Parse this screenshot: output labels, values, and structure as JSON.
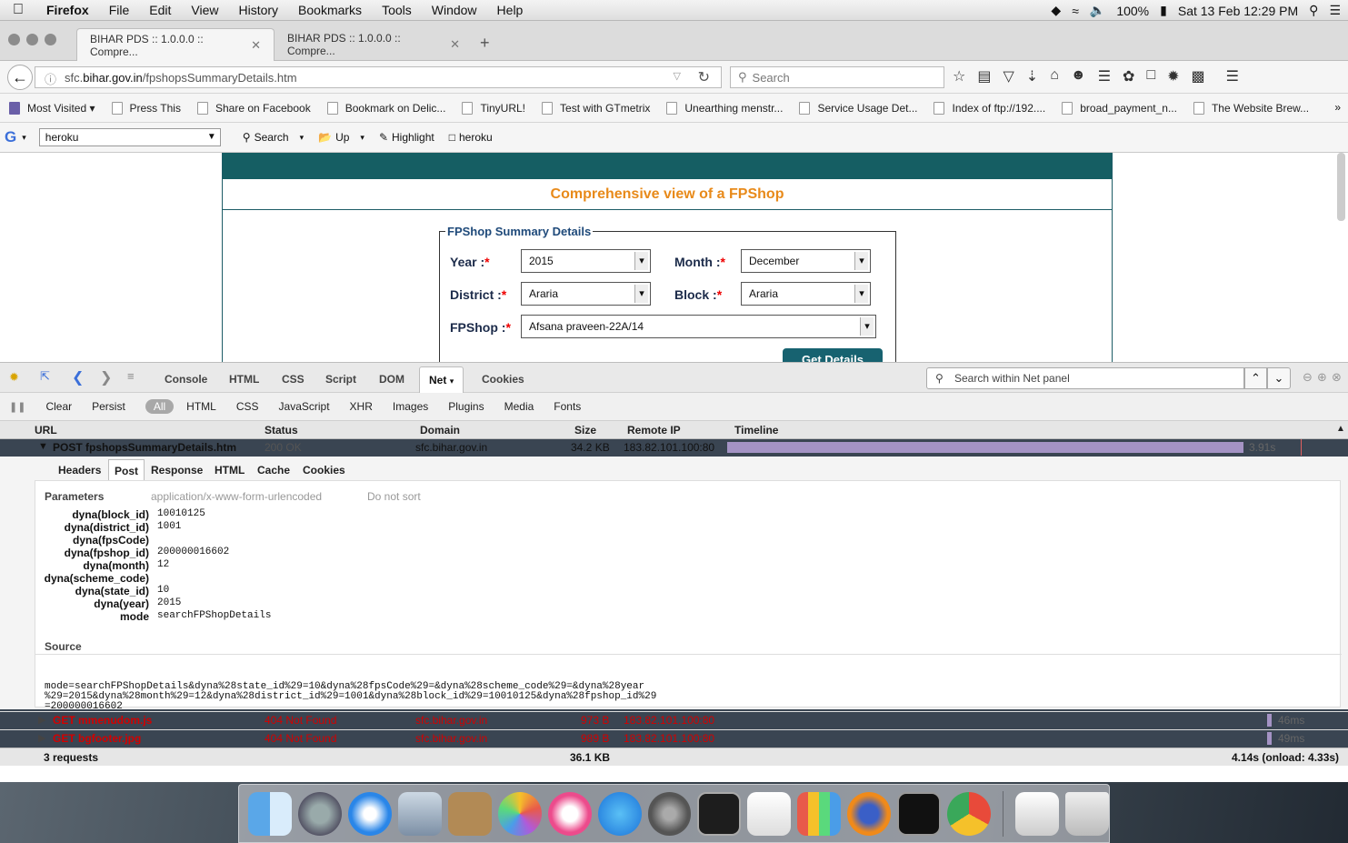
{
  "menubar": {
    "app": "Firefox",
    "items": [
      "File",
      "Edit",
      "View",
      "History",
      "Bookmarks",
      "Tools",
      "Window",
      "Help"
    ],
    "battery": "100%",
    "clock": "Sat 13 Feb  12:29 PM"
  },
  "tabs": [
    {
      "title": "BIHAR PDS :: 1.0.0.0 :: Compre..."
    },
    {
      "title": "BIHAR PDS :: 1.0.0.0 :: Compre..."
    }
  ],
  "nav": {
    "url_prefix": "sfc.",
    "url_host": "bihar.gov.in",
    "url_path": "/fpshopsSummaryDetails.htm",
    "search_placeholder": "Search"
  },
  "bookmarks": [
    "Most Visited",
    "Press This",
    "Share on Facebook",
    "Bookmark on Delic...",
    "TinyURL!",
    "Test with GTmetrix",
    "Unearthing menstr...",
    "Service Usage Det...",
    "Index of ftp://192....",
    "broad_payment_n...",
    "The Website Brew..."
  ],
  "gtoolbar": {
    "query": "heroku",
    "search": "Search",
    "up": "Up",
    "highlight": "Highlight",
    "term": "heroku"
  },
  "page": {
    "heading": "Comprehensive view of a FPShop",
    "legend": "FPShop Summary Details",
    "year_label": "Year :",
    "year_value": "2015",
    "month_label": "Month :",
    "month_value": "December",
    "district_label": "District :",
    "district_value": "Araria",
    "block_label": "Block :",
    "block_value": "Araria",
    "fpshop_label": "FPShop :",
    "fpshop_value": "Afsana praveen-22A/14",
    "required_mark": "*",
    "button": "Get Details"
  },
  "firebug": {
    "tabs": [
      "Console",
      "HTML",
      "CSS",
      "Script",
      "DOM",
      "Net",
      "Cookies"
    ],
    "search_placeholder": "Search within Net panel",
    "filters": [
      "Clear",
      "Persist",
      "All",
      "HTML",
      "CSS",
      "JavaScript",
      "XHR",
      "Images",
      "Plugins",
      "Media",
      "Fonts"
    ],
    "columns": [
      "URL",
      "Status",
      "Domain",
      "Size",
      "Remote IP",
      "Timeline"
    ],
    "requests": [
      {
        "url": "POST fpshopsSummaryDetails.htm",
        "status": "200 OK",
        "domain": "sfc.bihar.gov.in",
        "size": "34.2 KB",
        "ip": "183.82.101.100:80",
        "time": "3.91s"
      },
      {
        "url": "GET mmenudom.js",
        "status": "404 Not Found",
        "domain": "sfc.bihar.gov.in",
        "size": "973 B",
        "ip": "183.82.101.100:80",
        "time": "46ms"
      },
      {
        "url": "GET bgfooter.jpg",
        "status": "404 Not Found",
        "domain": "sfc.bihar.gov.in",
        "size": "989 B",
        "ip": "183.82.101.100:80",
        "time": "49ms"
      }
    ],
    "detail_tabs": [
      "Headers",
      "Post",
      "Response",
      "HTML",
      "Cache",
      "Cookies"
    ],
    "params_title": "Parameters",
    "params_type": "application/x-www-form-urlencoded",
    "params_sort": "Do not sort",
    "params": [
      {
        "name": "dyna(block_id)",
        "value": "10010125"
      },
      {
        "name": "dyna(district_id)",
        "value": "1001"
      },
      {
        "name": "dyna(fpsCode)",
        "value": ""
      },
      {
        "name": "dyna(fpshop_id)",
        "value": "200000016602"
      },
      {
        "name": "dyna(month)",
        "value": "12"
      },
      {
        "name": "dyna(scheme_code)",
        "value": ""
      },
      {
        "name": "dyna(state_id)",
        "value": "10"
      },
      {
        "name": "dyna(year)",
        "value": "2015"
      },
      {
        "name": "mode",
        "value": "searchFPShopDetails"
      }
    ],
    "source_title": "Source",
    "source": "mode=searchFPShopDetails&dyna%28state_id%29=10&dyna%28fpsCode%29=&dyna%28scheme_code%29=&dyna%28year\n%29=2015&dyna%28month%29=12&dyna%28district_id%29=1001&dyna%28block_id%29=10010125&dyna%28fpshop_id%29\n=200000016602",
    "footer_count": "3 requests",
    "footer_size": "36.1 KB",
    "footer_time": "4.14s (onload: 4.33s)"
  },
  "colors": {
    "accent": "#155e63",
    "heading": "#e88a1a",
    "error": "#d30000",
    "timeline_bar": "#a493c4"
  }
}
